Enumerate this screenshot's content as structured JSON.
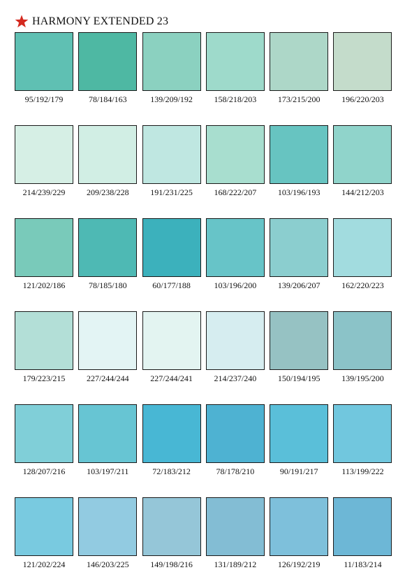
{
  "header": {
    "title": "HARMONY EXTENDED 23",
    "icon": "star-icon",
    "icon_color": "#d42a20"
  },
  "swatches": [
    {
      "label": "95/192/179",
      "color": "#5FC0B3"
    },
    {
      "label": "78/184/163",
      "color": "#4EB8A3"
    },
    {
      "label": "139/209/192",
      "color": "#8BD1C0"
    },
    {
      "label": "158/218/203",
      "color": "#9EDACB"
    },
    {
      "label": "173/215/200",
      "color": "#ADD7C8"
    },
    {
      "label": "196/220/203",
      "color": "#C4DCCB"
    },
    {
      "label": "214/239/229",
      "color": "#D6EFE5"
    },
    {
      "label": "209/238/228",
      "color": "#D1EEE4"
    },
    {
      "label": "191/231/225",
      "color": "#BFE7E1"
    },
    {
      "label": "168/222/207",
      "color": "#A8DECF"
    },
    {
      "label": "103/196/193",
      "color": "#67C4C1"
    },
    {
      "label": "144/212/203",
      "color": "#90D4CB"
    },
    {
      "label": "121/202/186",
      "color": "#79CABA"
    },
    {
      "label": "78/185/180",
      "color": "#4EB9B4"
    },
    {
      "label": "60/177/188",
      "color": "#3CB1BC"
    },
    {
      "label": "103/196/200",
      "color": "#67C4C8"
    },
    {
      "label": "139/206/207",
      "color": "#8BCECF"
    },
    {
      "label": "162/220/223",
      "color": "#A2DCDF"
    },
    {
      "label": "179/223/215",
      "color": "#B3DFD7"
    },
    {
      "label": "227/244/244",
      "color": "#E3F4F4"
    },
    {
      "label": "227/244/241",
      "color": "#E3F4F1"
    },
    {
      "label": "214/237/240",
      "color": "#D6EDF0"
    },
    {
      "label": "150/194/195",
      "color": "#96C2C3"
    },
    {
      "label": "139/195/200",
      "color": "#8BC3C8"
    },
    {
      "label": "128/207/216",
      "color": "#80CFD8"
    },
    {
      "label": "103/197/211",
      "color": "#67C5D3"
    },
    {
      "label": "72/183/212",
      "color": "#48B7D4"
    },
    {
      "label": "78/178/210",
      "color": "#4EB2D2"
    },
    {
      "label": "90/191/217",
      "color": "#5ABFD9"
    },
    {
      "label": "113/199/222",
      "color": "#71C7DE"
    },
    {
      "label": "121/202/224",
      "color": "#79CAE0"
    },
    {
      "label": "146/203/225",
      "color": "#92CBE1"
    },
    {
      "label": "149/198/216",
      "color": "#95C6D8"
    },
    {
      "label": "131/189/212",
      "color": "#83BDD4"
    },
    {
      "label": "126/192/219",
      "color": "#7EC0DB"
    },
    {
      "label": "11/183/214",
      "color": "#6DB7D6"
    }
  ]
}
